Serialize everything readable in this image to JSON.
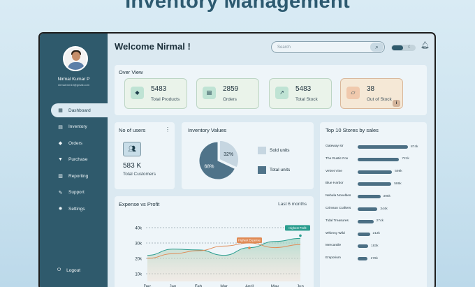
{
  "page": {
    "hero_title": "Inventory Management"
  },
  "sidebar": {
    "user_name": "Nirmal Kumar P",
    "user_email": "nirmalvnm10@gmail.com",
    "items": [
      {
        "label": "Dashboard",
        "icon": "grid-icon",
        "active": true
      },
      {
        "label": "Inventory",
        "icon": "box-icon"
      },
      {
        "label": "Orders",
        "icon": "cube-icon"
      },
      {
        "label": "Purchase",
        "icon": "cart-icon"
      },
      {
        "label": "Reporting",
        "icon": "chart-icon"
      },
      {
        "label": "Support",
        "icon": "wrench-icon"
      },
      {
        "label": "Settings",
        "icon": "gear-icon"
      }
    ],
    "logout_label": "Logout"
  },
  "header": {
    "welcome": "Welcome Nirmal !",
    "search_placeholder": "Search"
  },
  "overview": {
    "title": "Over View",
    "stats": [
      {
        "value": "5483",
        "label": "Total Products",
        "icon": "cube-icon"
      },
      {
        "value": "2859",
        "label": "Orders",
        "icon": "box-icon"
      },
      {
        "value": "5483",
        "label": "Total Stock",
        "icon": "trend-icon"
      },
      {
        "value": "38",
        "label": "Out of Stock",
        "icon": "empty-box-icon"
      }
    ]
  },
  "users": {
    "title": "No of users",
    "value": "583 K",
    "label": "Total Customers"
  },
  "inventory_values": {
    "title": "Inventory Values",
    "legend": [
      "Sold units",
      "Total units"
    ]
  },
  "expense": {
    "title": "Expense vs Profit",
    "period": "Last 6 months"
  },
  "top_stores": {
    "title": "Top 10 Stores by sales"
  },
  "colors": {
    "sidebar": "#2f5a6c",
    "bar": "#4b6f84",
    "accent_orange": "#e08a55",
    "accent_teal": "#2a9d8f"
  },
  "chart_data": [
    {
      "type": "pie",
      "title": "Inventory Values",
      "categories": [
        "Sold units",
        "Total units"
      ],
      "values": [
        32,
        68
      ],
      "labels": [
        "32%",
        "68%"
      ],
      "colors": [
        "#c6d6e1",
        "#4f7389"
      ]
    },
    {
      "type": "bar",
      "orientation": "horizontal",
      "title": "Top 10 Stores by sales",
      "categories": [
        "Gateway str",
        "The Rustic Fox",
        "Velvet Vine",
        "Blue Harbor",
        "Nebula Novelties",
        "Crimson Crafters",
        "Tidal Treasures",
        "Whimsy Wild",
        "Mercantile",
        "Emporium"
      ],
      "values": [
        874,
        721,
        598,
        586,
        395,
        344,
        274,
        213,
        183,
        176
      ],
      "value_labels": [
        "874k",
        "721k",
        "598k",
        "586k",
        "395k",
        "344k",
        "274k",
        "213k",
        "183k",
        "176k"
      ],
      "xlim": [
        0,
        874
      ]
    },
    {
      "type": "area",
      "title": "Expense vs Profit",
      "categories": [
        "Dec",
        "Jan",
        "Feb",
        "Mar",
        "April",
        "May",
        "Jun"
      ],
      "y_ticks": [
        "10k",
        "20k",
        "30k",
        "40k"
      ],
      "ylim": [
        5,
        45
      ],
      "series": [
        {
          "values": [
            22,
            26,
            25.5,
            22,
            27,
            31,
            33
          ],
          "color": "#2a9d8f"
        },
        {
          "values": [
            20,
            23,
            25,
            28,
            30,
            27,
            29
          ],
          "color": "#e08a55"
        }
      ],
      "annotations": [
        {
          "text": "Highest Expense",
          "x": "April",
          "y": 30
        },
        {
          "text": "Highest Profit",
          "x": "Jun",
          "y": 38
        }
      ]
    }
  ]
}
